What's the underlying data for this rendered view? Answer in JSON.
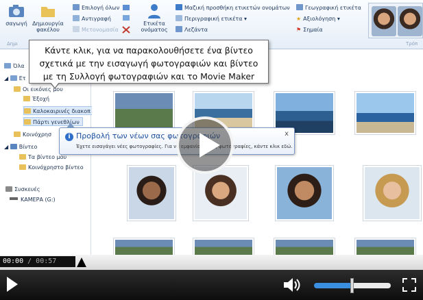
{
  "ribbon": {
    "import_label": "σαγωγή",
    "new_folder_label": "Δημιουργία φακέλου",
    "select_all": "Επιλογή όλων",
    "copy": "Αντιγραφή",
    "rename": "Μετονομασία",
    "people_tag": "Ετικέτα ονόματος",
    "batch_people_tag": "Μαζική προσθήκη ετικετών ονομάτων",
    "descriptive_tag": "Περιγραφική ετικέτα",
    "caption": "Λεζάντα",
    "geotag": "Γεωγραφική ετικέτα",
    "rating": "Αξιολόγηση",
    "flag": "Σημαία",
    "group_label_left": "Δημι",
    "group_label_right": "Τρόπ"
  },
  "tooltip": {
    "text": "Κάντε κλικ, για να παρακολουθήσετε ένα βίντεο σχετικά με την εισαγωγή φωτογραφιών και βίντεο με τη Συλλογή φωτογραφιών και το Movie Maker"
  },
  "nav": {
    "all": "Όλα",
    "parent": "Ετ",
    "my_pictures": "Οι εικόνες μου",
    "outdoors": "Έξοχή",
    "holidays": "Καλοκαιρινές διακοπ",
    "birthday": "Πάρτι γενεθλίων",
    "public_pictures": "Κοινόχρησ",
    "videos": "Βίντεο",
    "my_videos": "Τα βίντεο μου",
    "public_videos": "Κοινόχρηστο βίντεο",
    "devices": "Συσκευές",
    "camera": "ΚΑΜΕΡΑ (G:)"
  },
  "notification": {
    "title": "Προβολή των νέων σας φωτογραφιών",
    "body": "Έχετε εισαγάγει νέες φωτογραφίες. Για να εμφανίσετε τις φωτογραφίες, κάντε κλικ εδώ.",
    "close": "x"
  },
  "player": {
    "current_time": "00:00",
    "separator": " / ",
    "duration": "00:57",
    "progress": 0,
    "volume": 0.5
  },
  "icons": {
    "play": "play-icon",
    "volume": "speaker-icon",
    "fullscreen": "fullscreen-icon"
  }
}
